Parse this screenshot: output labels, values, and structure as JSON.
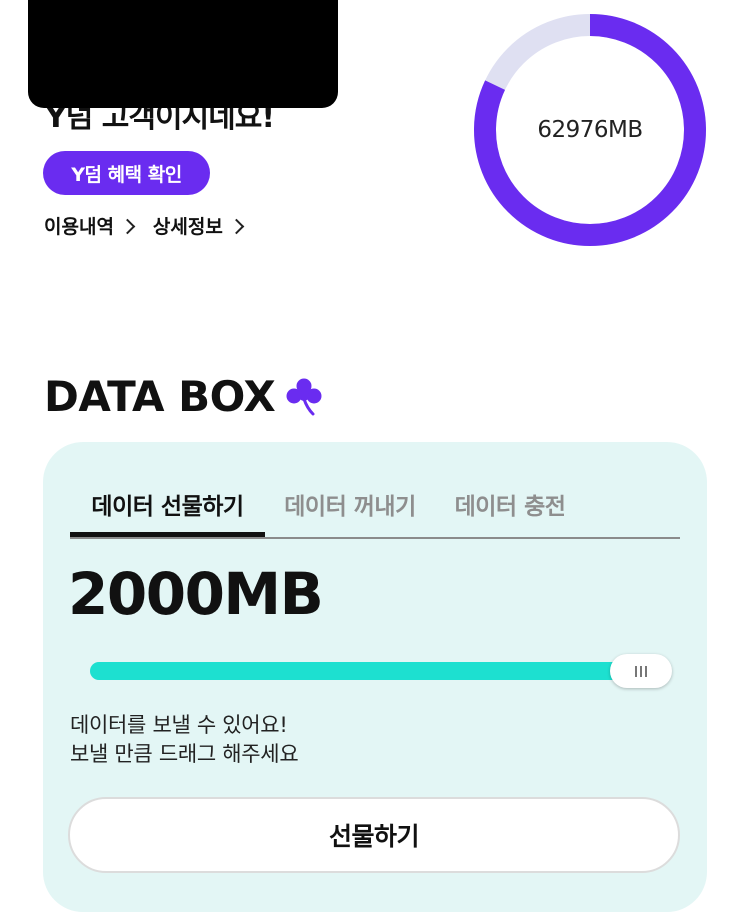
{
  "header": {
    "greeting_partial": "Y덤 고객이시네요!",
    "benefit_button_label": "Y덤 혜택 확인",
    "links": [
      {
        "label": "이용내역"
      },
      {
        "label": "상세정보"
      }
    ]
  },
  "usage_donut": {
    "label": "62976MB",
    "fill_fraction": 0.82,
    "accent_color": "#6a2cf0",
    "track_color": "#dfe0f2"
  },
  "databox": {
    "title": "DATA BOX",
    "icon": "clover-icon",
    "tabs": [
      {
        "label": "데이터 선물하기",
        "active": true
      },
      {
        "label": "데이터 꺼내기",
        "active": false
      },
      {
        "label": "데이터 충전",
        "active": false
      }
    ],
    "amount": "2000MB",
    "slider": {
      "level": 0.95,
      "fill_color": "#1de0d0"
    },
    "hint_line1": "데이터를 보낼 수 있어요!",
    "hint_line2": "보낼 만큼 드래그 해주세요",
    "gift_button_label": "선물하기"
  }
}
